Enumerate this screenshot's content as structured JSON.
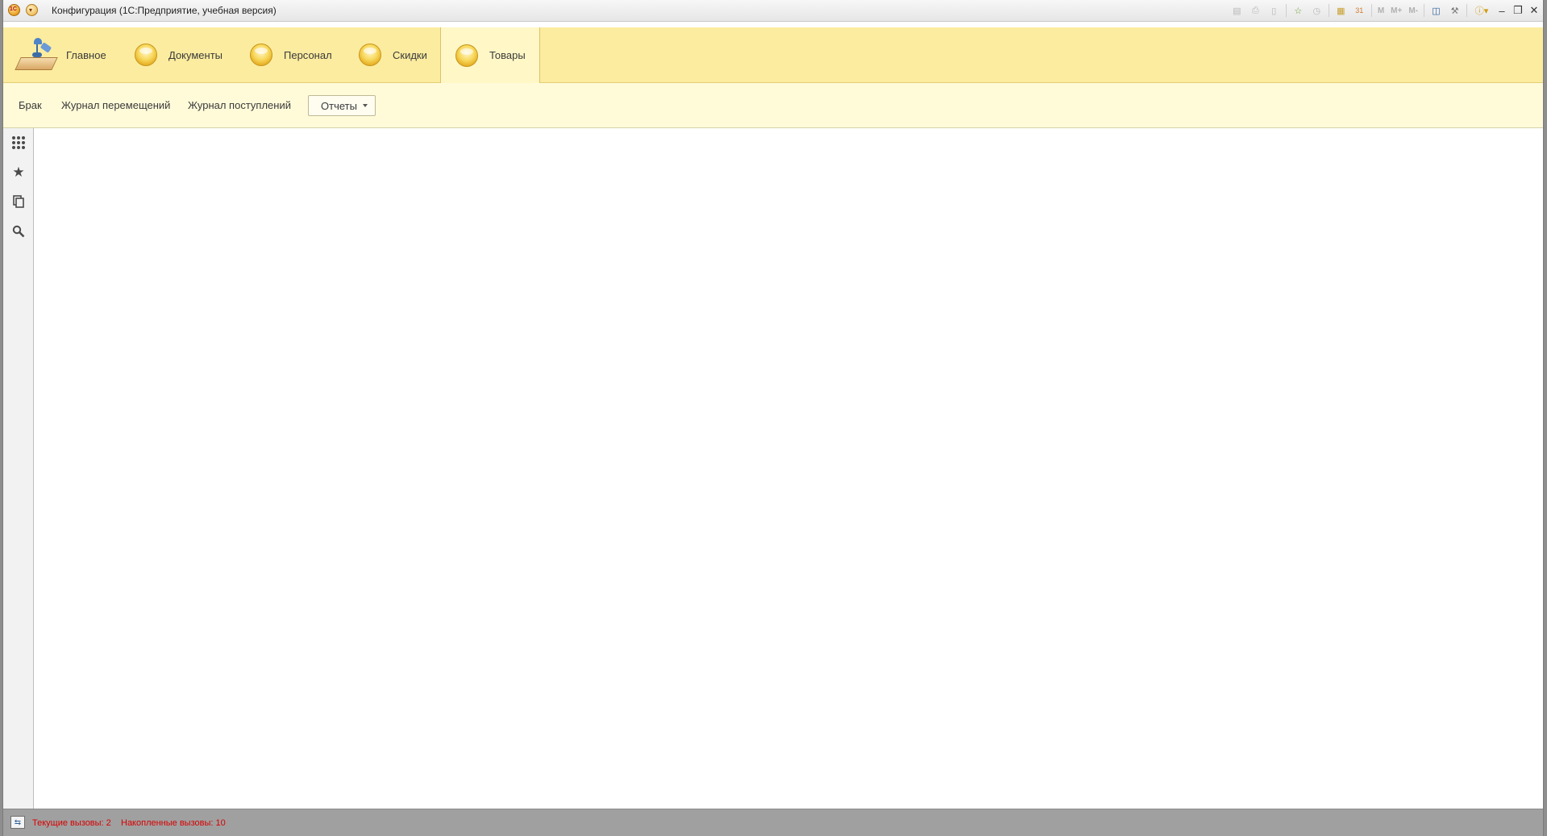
{
  "window": {
    "title": "Конфигурация  (1С:Предприятие, учебная версия)",
    "logo_text": "1С"
  },
  "toolbar": {
    "icons": [
      "save-icon",
      "print-icon",
      "preview-icon",
      "favorite-add-icon",
      "history-icon",
      "calculator-icon",
      "calendar-icon"
    ],
    "memory": [
      "M",
      "M+",
      "M-"
    ],
    "window_controls": [
      "minimize-icon",
      "restore-icon",
      "close-icon"
    ]
  },
  "sections": [
    {
      "label": "Главное",
      "active": false
    },
    {
      "label": "Документы",
      "active": false
    },
    {
      "label": "Персонал",
      "active": false
    },
    {
      "label": "Скидки",
      "active": false
    },
    {
      "label": "Товары",
      "active": true
    }
  ],
  "commands": {
    "items": [
      "Брак",
      "Журнал перемещений",
      "Журнал поступлений"
    ],
    "reports_label": "Отчеты"
  },
  "sidebar": {
    "icons": [
      "functions-menu-icon",
      "favorites-star-icon",
      "history-icon",
      "search-icon"
    ]
  },
  "status": {
    "current_calls": "Текущие вызовы: 2",
    "accumulated_calls": "Накопленные вызовы: 10"
  },
  "colors": {
    "sections_bg": "#fcec9f",
    "commands_bg": "#fffbd9",
    "status_text": "#d80000"
  }
}
